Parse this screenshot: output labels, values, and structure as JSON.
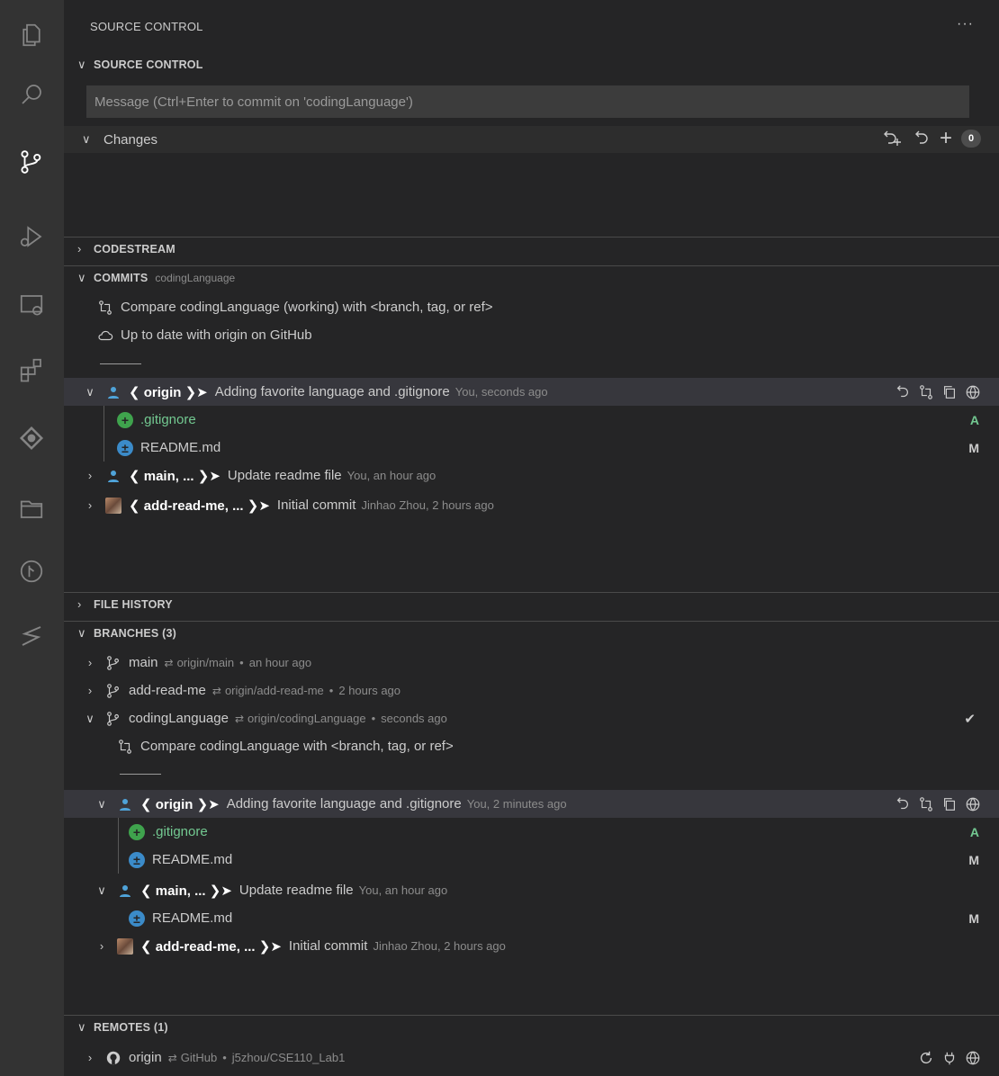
{
  "top_title": "SOURCE CONTROL",
  "top_more": "···",
  "source_control": {
    "header": "SOURCE CONTROL",
    "message_placeholder": "Message (Ctrl+Enter to commit on 'codingLanguage')",
    "changes_label": "Changes",
    "changes_count": "0"
  },
  "codestream": {
    "header": "CODESTREAM"
  },
  "commits": {
    "header": "COMMITS",
    "branch": "codingLanguage",
    "compare_text": "Compare codingLanguage (working) with <branch, tag, or ref>",
    "up_to_date_text": "Up to date with origin on GitHub",
    "items": [
      {
        "refs": "❮ origin ❯➤",
        "message": "Adding favorite language and .gitignore",
        "meta": "You, seconds ago"
      },
      {
        "refs": "❮ main, ... ❯➤",
        "message": "Update readme file",
        "meta": "You, an hour ago"
      },
      {
        "refs": "❮ add-read-me, ... ❯➤",
        "message": "Initial commit",
        "meta": "Jinhao Zhou, 2 hours ago"
      }
    ],
    "files": [
      {
        "name": ".gitignore",
        "status": "A"
      },
      {
        "name": "README.md",
        "status": "M"
      }
    ]
  },
  "file_history": {
    "header": "FILE HISTORY"
  },
  "branches": {
    "header": "BRANCHES (3)",
    "items": [
      {
        "name": "main",
        "upstream": "origin/main",
        "time": "an hour ago"
      },
      {
        "name": "add-read-me",
        "upstream": "origin/add-read-me",
        "time": "2 hours ago"
      },
      {
        "name": "codingLanguage",
        "upstream": "origin/codingLanguage",
        "time": "seconds ago"
      }
    ],
    "compare_text": "Compare codingLanguage with <branch, tag, or ref>",
    "commits": [
      {
        "refs": "❮ origin ❯➤",
        "message": "Adding favorite language and .gitignore",
        "meta": "You, 2 minutes ago"
      },
      {
        "refs": "❮ main, ... ❯➤",
        "message": "Update readme file",
        "meta": "You, an hour ago"
      },
      {
        "refs": "❮ add-read-me, ... ❯➤",
        "message": "Initial commit",
        "meta": "Jinhao Zhou, 2 hours ago"
      }
    ],
    "files": [
      {
        "name": ".gitignore",
        "status": "A"
      },
      {
        "name": "README.md",
        "status": "M"
      },
      {
        "name": "README.md",
        "status": "M"
      }
    ]
  },
  "remotes": {
    "header": "REMOTES (1)",
    "name": "origin",
    "provider": "GitHub",
    "repo": "j5zhou/CSE110_Lab1"
  },
  "symbols": {
    "bullet": "•",
    "arrow": "⇄",
    "check": "✔",
    "chev_down": "∨",
    "chev_right": "›",
    "plus": "+"
  }
}
